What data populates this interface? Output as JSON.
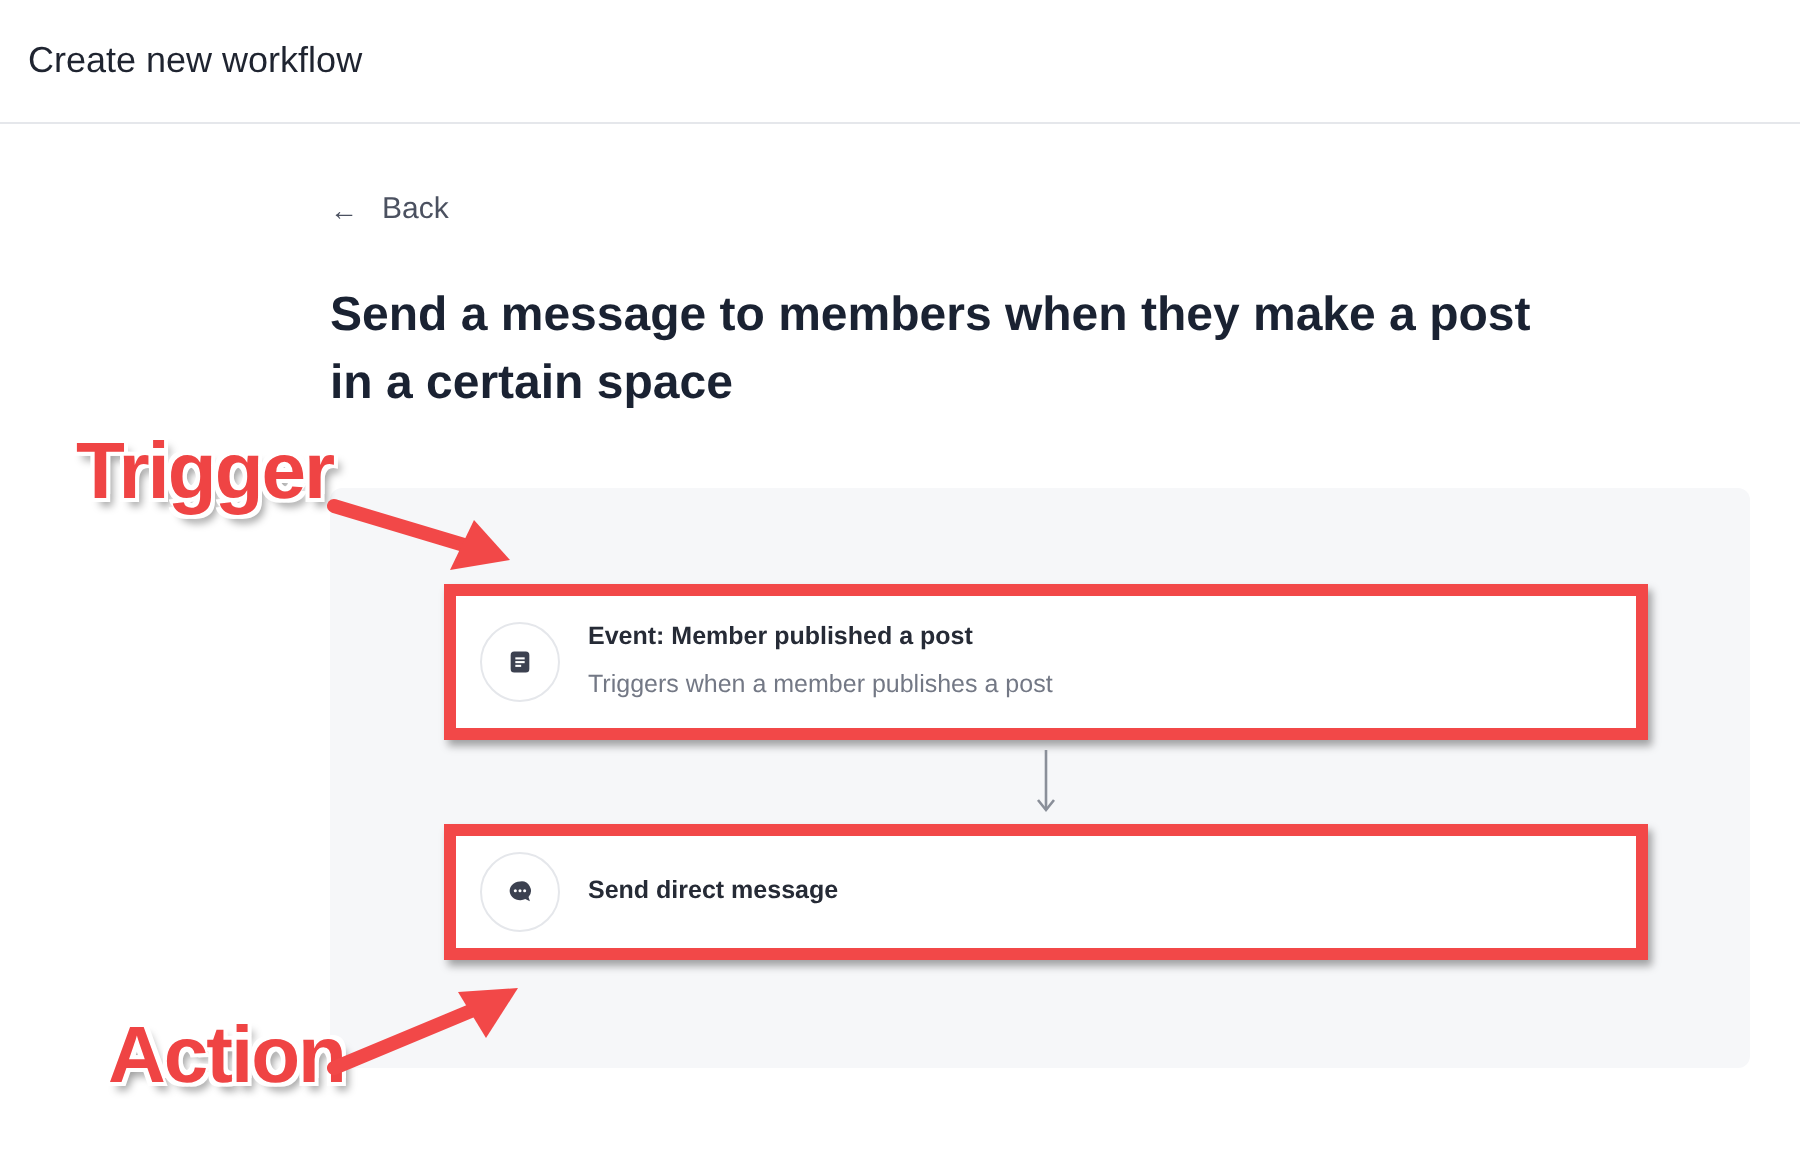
{
  "header": {
    "title": "Create new workflow"
  },
  "back_link": {
    "icon": "←",
    "label": "Back"
  },
  "heading": "Send a message to members when they make a post in a certain space",
  "steps": [
    {
      "kind": "event",
      "title": "Event: Member published a post",
      "description": "Triggers when a member publishes a post",
      "highlighted": true
    },
    {
      "kind": "message",
      "title": "Send direct message",
      "highlighted": true
    }
  ],
  "annotations": [
    {
      "label": "Trigger"
    },
    {
      "label": "Action"
    }
  ]
}
